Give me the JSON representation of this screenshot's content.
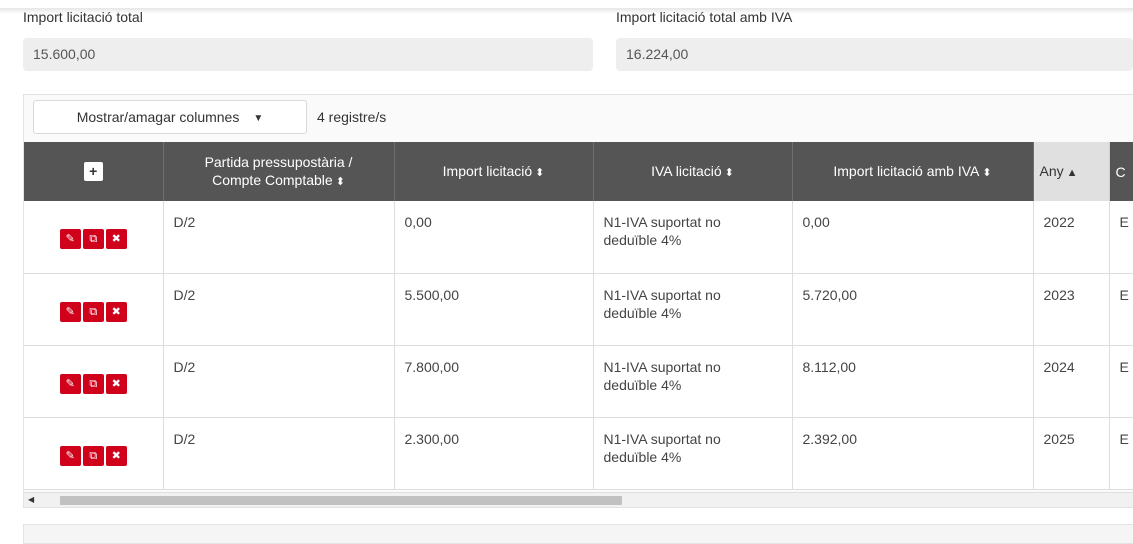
{
  "fields": {
    "total": {
      "label": "Import licitació total",
      "value": "15.600,00"
    },
    "total_iva": {
      "label": "Import licitació total amb IVA",
      "value": "16.224,00"
    }
  },
  "toolbar": {
    "columns_button": "Mostrar/amagar columnes",
    "records": "4 registre/s"
  },
  "table": {
    "add_label": "+",
    "headers": {
      "partida_line1": "Partida pressupostària /",
      "partida_line2": "Compte Comptable",
      "import": "Import licitació",
      "iva": "IVA licitació",
      "import_iva": "Import licitació amb IVA",
      "any": "Any",
      "next": "C"
    },
    "rows": [
      {
        "partida": "D/2",
        "import": "0,00",
        "iva_line1": "N1-IVA suportat no",
        "iva_line2": "deduïble 4%",
        "import_iva": "0,00",
        "any": "2022",
        "next": "E"
      },
      {
        "partida": "D/2",
        "import": "5.500,00",
        "iva_line1": "N1-IVA suportat no",
        "iva_line2": "deduïble 4%",
        "import_iva": "5.720,00",
        "any": "2023",
        "next": "E"
      },
      {
        "partida": "D/2",
        "import": "7.800,00",
        "iva_line1": "N1-IVA suportat no",
        "iva_line2": "deduïble 4%",
        "import_iva": "8.112,00",
        "any": "2024",
        "next": "E"
      },
      {
        "partida": "D/2",
        "import": "2.300,00",
        "iva_line1": "N1-IVA suportat no",
        "iva_line2": "deduïble 4%",
        "import_iva": "2.392,00",
        "any": "2025",
        "next": "E"
      }
    ]
  },
  "colors": {
    "header_bg": "#555555",
    "action_red": "#d0021b",
    "sorted_header": "#e0e0e0"
  }
}
